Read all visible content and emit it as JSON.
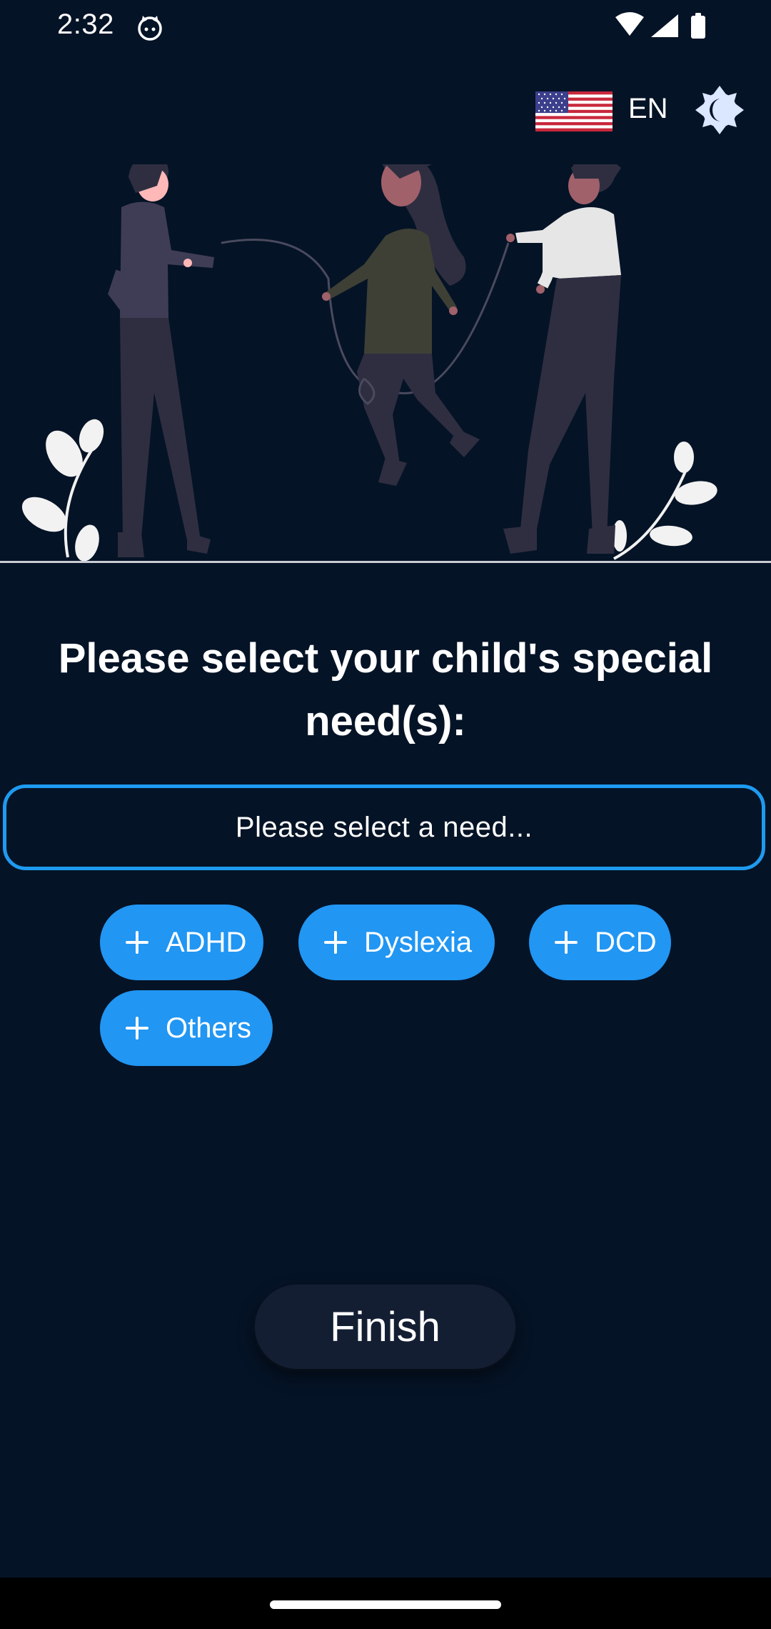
{
  "status_bar": {
    "time": "2:32",
    "icons": [
      "cat-icon",
      "wifi-icon",
      "signal-icon",
      "battery-icon"
    ]
  },
  "header": {
    "language_flag": "us-flag-icon",
    "language_code": "EN",
    "theme_toggle_icon": "theme-toggle-icon"
  },
  "main": {
    "title": "Please select your child's special need(s):",
    "select_placeholder": "Please select a need...",
    "chips": [
      {
        "label": "ADHD",
        "icon": "plus-icon"
      },
      {
        "label": "Dyslexia",
        "icon": "plus-icon"
      },
      {
        "label": "DCD",
        "icon": "plus-icon"
      },
      {
        "label": "Others",
        "icon": "plus-icon"
      }
    ],
    "finish_label": "Finish"
  },
  "colors": {
    "background": "#051326",
    "accent": "#2196f3",
    "select_border": "#1e9bf0",
    "button_bg": "#141e33"
  }
}
